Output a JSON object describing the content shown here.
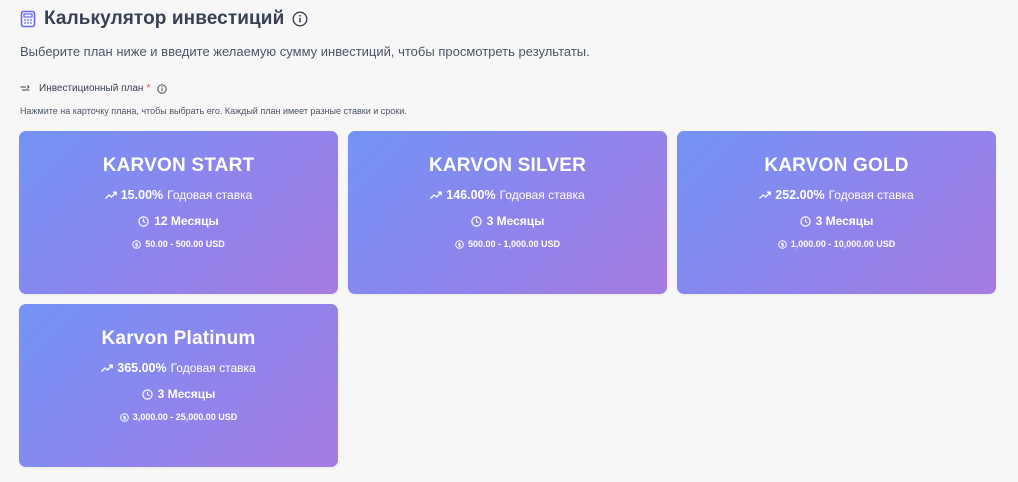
{
  "header": {
    "title": "Калькулятор инвестиций",
    "icon": "calculator-icon",
    "info_icon": "info-icon"
  },
  "subtitle": "Выберите план ниже и введите желаемую сумму инвестиций, чтобы просмотреть результаты.",
  "plan_field": {
    "label": "Инвестиционный план",
    "required_mark": "*",
    "hint": "Нажмите на карточку плана, чтобы выбрать его. Каждый план имеет разные ставки и сроки."
  },
  "colors": {
    "gradient_start": "#7393f6",
    "gradient_end": "#a67ce2",
    "accent": "#6366f1",
    "required": "#ef4444"
  },
  "plans": [
    {
      "name": "KARVON START",
      "rate": "15.00%",
      "rate_label": "Годовая ставка",
      "term": "12 Месяцы",
      "range": "50.00 - 500.00 USD"
    },
    {
      "name": "KARVON SILVER",
      "rate": "146.00%",
      "rate_label": "Годовая ставка",
      "term": "3 Месяцы",
      "range": "500.00 - 1,000.00 USD"
    },
    {
      "name": "KARVON GOLD",
      "rate": "252.00%",
      "rate_label": "Годовая ставка",
      "term": "3 Месяцы",
      "range": "1,000.00 - 10,000.00 USD"
    },
    {
      "name": "Karvon Platinum",
      "rate": "365.00%",
      "rate_label": "Годовая ставка",
      "term": "3 Месяцы",
      "range": "3,000.00 - 25,000.00 USD"
    }
  ]
}
